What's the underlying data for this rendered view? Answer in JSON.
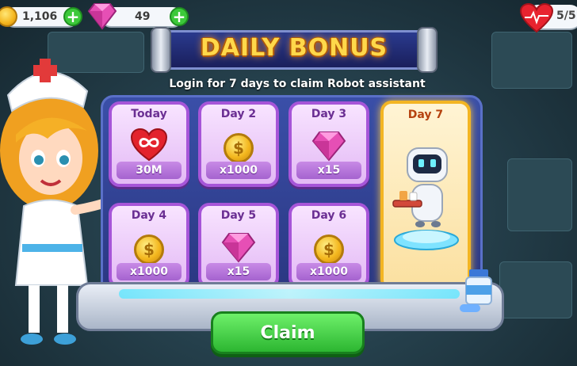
{
  "hud": {
    "coins": "1,106",
    "gems": "49",
    "lives": "5/5",
    "plus_label": "+"
  },
  "banner": {
    "title": "DAILY BONUS",
    "subtitle": "Login for 7 days to claim Robot assistant"
  },
  "rewards": [
    {
      "day": "Today",
      "amount": "30M",
      "icon": "infinity-heart-icon"
    },
    {
      "day": "Day 2",
      "amount": "x1000",
      "icon": "coin-icon"
    },
    {
      "day": "Day 3",
      "amount": "x15",
      "icon": "gem-icon"
    },
    {
      "day": "Day 4",
      "amount": "x1000",
      "icon": "coin-icon"
    },
    {
      "day": "Day 5",
      "amount": "x15",
      "icon": "gem-icon"
    },
    {
      "day": "Day 6",
      "amount": "x1000",
      "icon": "coin-icon"
    },
    {
      "day": "Day 7",
      "amount": "",
      "icon": "robot-assistant-icon"
    }
  ],
  "claim_label": "Claim",
  "colors": {
    "claim_green": "#2cb631",
    "card_purple": "#a655d8",
    "day7_gold": "#f3b523",
    "banner_yellow": "#ffd84a"
  }
}
